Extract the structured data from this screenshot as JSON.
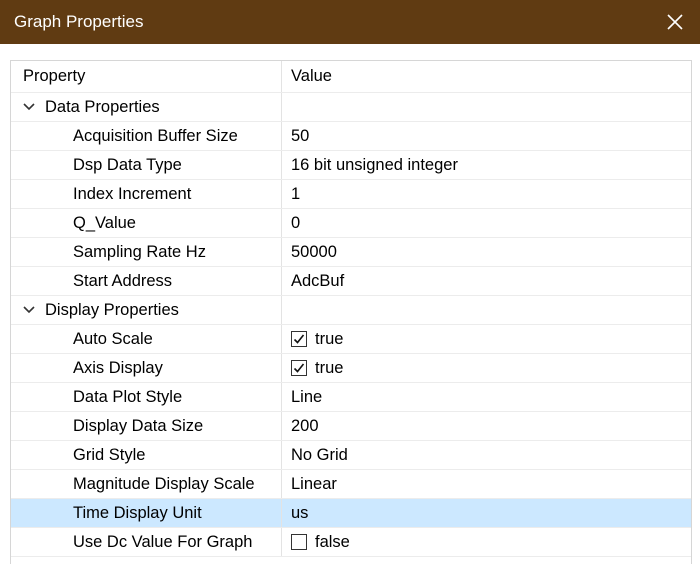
{
  "window": {
    "title": "Graph Properties"
  },
  "grid": {
    "header": {
      "property": "Property",
      "value": "Value"
    },
    "groups": [
      {
        "label": "Data Properties",
        "rows": [
          {
            "name": "Acquisition Buffer Size",
            "value": "50"
          },
          {
            "name": "Dsp Data Type",
            "value": "16 bit unsigned integer"
          },
          {
            "name": "Index Increment",
            "value": "1"
          },
          {
            "name": "Q_Value",
            "value": "0"
          },
          {
            "name": "Sampling Rate Hz",
            "value": "50000"
          },
          {
            "name": "Start Address",
            "value": "AdcBuf"
          }
        ]
      },
      {
        "label": "Display Properties",
        "rows": [
          {
            "name": "Auto Scale",
            "value": "true",
            "checkbox": true,
            "checked": true
          },
          {
            "name": "Axis Display",
            "value": "true",
            "checkbox": true,
            "checked": true
          },
          {
            "name": "Data Plot Style",
            "value": "Line"
          },
          {
            "name": "Display Data Size",
            "value": "200"
          },
          {
            "name": "Grid Style",
            "value": "No Grid"
          },
          {
            "name": "Magnitude Display Scale",
            "value": "Linear"
          },
          {
            "name": "Time Display Unit",
            "value": "us",
            "selected": true
          },
          {
            "name": "Use Dc Value For Graph",
            "value": "false",
            "checkbox": true,
            "checked": false
          }
        ]
      }
    ]
  },
  "colors": {
    "titlebar": "#603b12",
    "selected_row": "#cce8ff"
  },
  "icons": {
    "close": "close-icon",
    "expander": "chevron-down-icon",
    "checkbox": "checkmark-icon"
  }
}
